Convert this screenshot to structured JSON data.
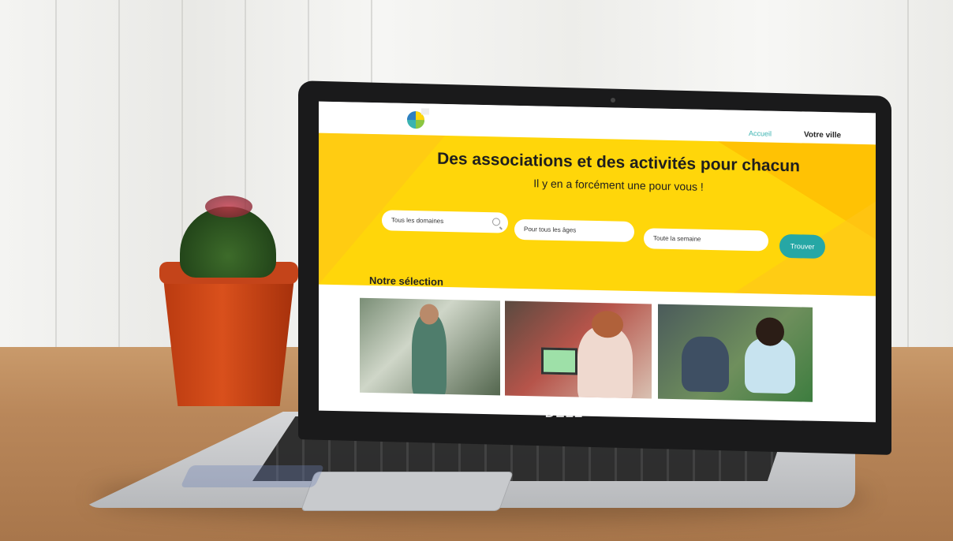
{
  "header": {
    "nav_home": "Accueil",
    "nav_city": "Votre ville"
  },
  "hero": {
    "title": "Des associations et des activités pour chacun",
    "subtitle": "Il y en a forcément une pour vous !"
  },
  "search": {
    "domain_placeholder": "Tous les domaines",
    "age_placeholder": "Pour tous les âges",
    "week_placeholder": "Toute la semaine",
    "submit_label": "Trouver"
  },
  "selection": {
    "title": "Notre sélection",
    "cards": [
      {
        "image": "man-with-phone-photo"
      },
      {
        "image": "woman-with-laptop-photo"
      },
      {
        "image": "children-on-grass-photo"
      }
    ]
  },
  "device": {
    "brand": "DELL"
  },
  "colors": {
    "hero_yellow": "#ffd60a",
    "accent_teal": "#26a7a5"
  }
}
